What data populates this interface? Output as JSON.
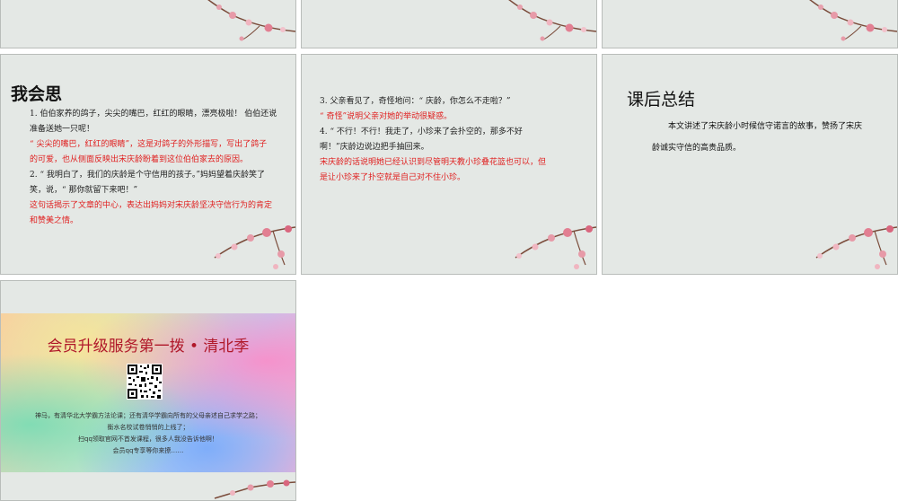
{
  "slide4": {
    "title": "我会思",
    "lines": [
      {
        "text": "1. 伯伯家养的鸽子，尖尖的嘴巴，红红的眼睛，漂亮极啦！ 伯伯还说",
        "color": "black"
      },
      {
        "text": "准备送她一只呢！",
        "color": "black"
      },
      {
        "text": "“ 尖尖的嘴巴，红红的眼睛”，这是对鸽子的外形描写，写出了鸽子",
        "color": "red"
      },
      {
        "text": "的可爱，也从侧面反映出宋庆龄盼着到这位伯伯家去的原因。",
        "color": "red"
      },
      {
        "text": "2. “ 我明白了，我们的庆龄是个守信用的孩子。”妈妈望着庆龄笑了",
        "color": "black"
      },
      {
        "text": "笑，说，“ 那你就留下来吧！”",
        "color": "black"
      },
      {
        "text": "这句话揭示了文章的中心，表达出妈妈对宋庆龄坚决守信行为的肯定",
        "color": "red"
      },
      {
        "text": "和赞美之情。",
        "color": "red"
      }
    ]
  },
  "slide5": {
    "lines": [
      {
        "text": "3. 父亲看见了，奇怪地问：“ 庆龄，你怎么不走啦？”",
        "color": "black"
      },
      {
        "text": "“ 奇怪”说明父亲对她的举动很疑惑。",
        "color": "red"
      },
      {
        "text": "4. “ 不行！不行！我走了，小珍来了会扑空的，那多不好",
        "color": "black"
      },
      {
        "text": "啊！”庆龄边说边把手抽回来。",
        "color": "black"
      },
      {
        "text": "宋庆龄的话说明她已经认识到尽管明天教小珍叠花篮也可以，但",
        "color": "red"
      },
      {
        "text": "是让小珍来了扑空就是自己对不住小珍。",
        "color": "red"
      }
    ]
  },
  "slide6": {
    "title": "课后总结",
    "body": "本文讲述了宋庆龄小时候信守诺言的故事，赞扬了宋庆龄诚实守信的高贵品质。"
  },
  "slide7": {
    "title": "会员升级服务第一拨 • 清北季",
    "lines": [
      "神马，有清华北大学霸方法论课；还有清华学霸向所有的父母亲述自己求学之路；",
      "衡水名校试卷悄悄的上线了；",
      "扫qq领取官网不首发课程，很多人我没告诉他啊！",
      "会员qq专享等你来撩……"
    ]
  }
}
